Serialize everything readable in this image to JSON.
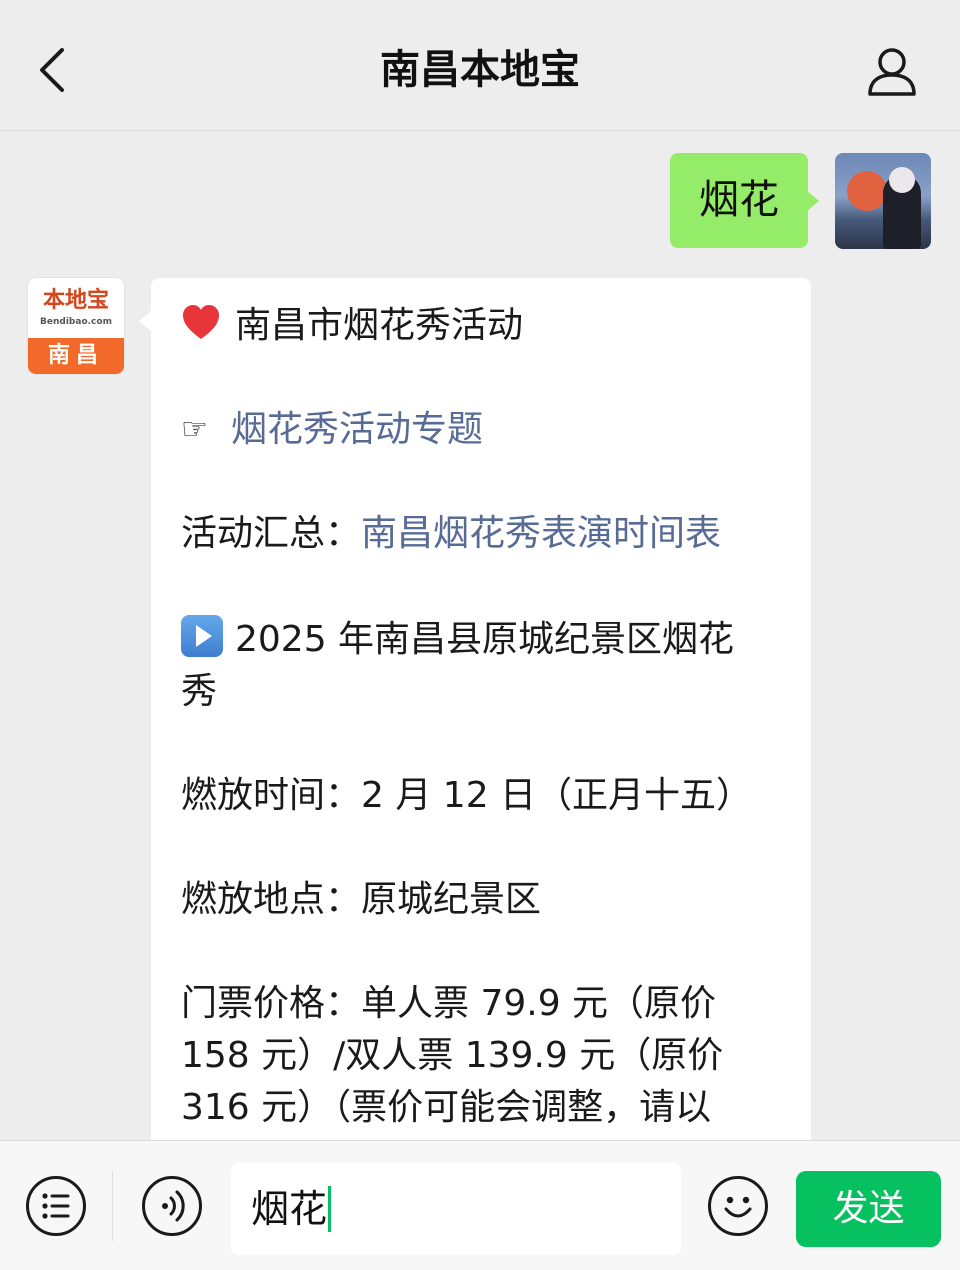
{
  "header": {
    "title": "南昌本地宝",
    "back_icon": "chevron-left-icon",
    "profile_icon": "person-icon"
  },
  "outgoing": {
    "text": "烟花"
  },
  "incoming": {
    "avatar": {
      "logo_text": "本地宝",
      "logo_sub": "Bendibao.com",
      "city": "南昌"
    },
    "heading": "南昌市烟花秀活动",
    "topic_icon": "☞",
    "topic_link": "烟花秀活动专题",
    "summary_label": "活动汇总：",
    "summary_link": "南昌烟花秀表演时间表",
    "event_title_line1": "2025 年南昌县原城纪景区烟花",
    "event_title_line2": "秀",
    "time_label": "燃放时间：2 月 12 日（正月十五）",
    "place_label": "燃放地点：原城纪景区",
    "price_line1": "门票价格：单人票 79.9 元（原价",
    "price_line2": "158 元）/双人票 139.9 元（原价",
    "price_line3": "316 元）（票价可能会调整，请以"
  },
  "input": {
    "value": "烟花",
    "send_label": "发送"
  },
  "colors": {
    "bubble_out": "#95ec69",
    "link": "#576b95",
    "send": "#07c160"
  }
}
